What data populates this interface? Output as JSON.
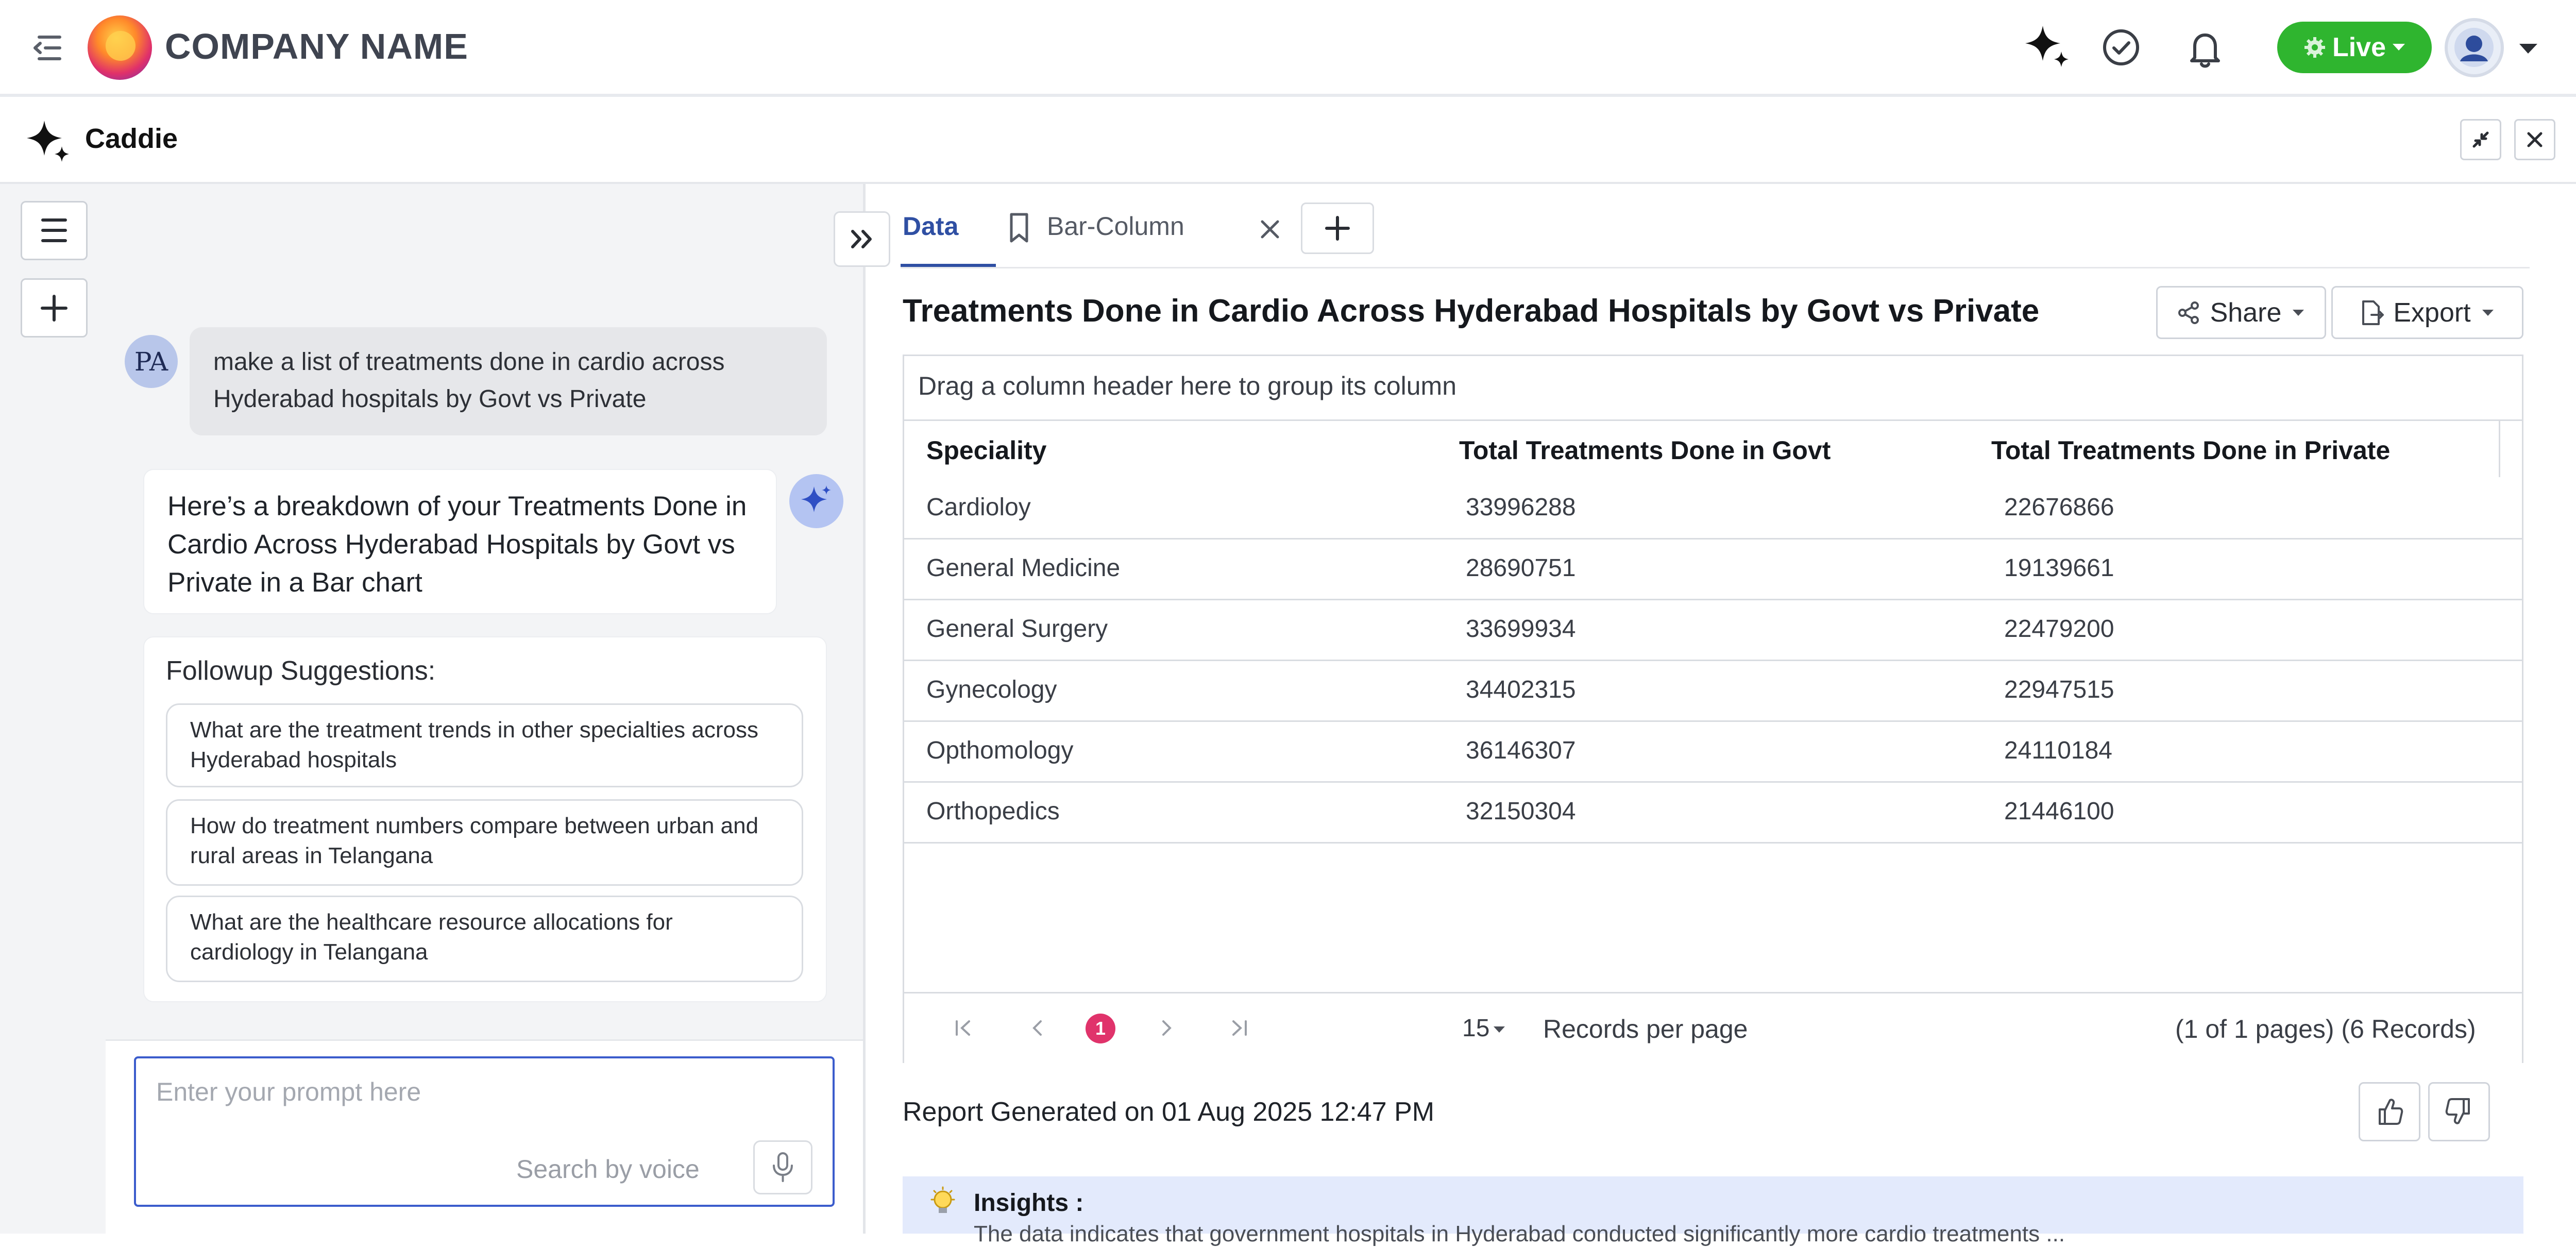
{
  "header": {
    "company_name": "COMPANY NAME",
    "live_label": "Live",
    "icons": [
      "menu-collapse-icon",
      "sparkle-icon",
      "check-circle-icon",
      "bell-icon",
      "avatar",
      "chevron-down-icon"
    ]
  },
  "caddie": {
    "title": "Caddie"
  },
  "chat": {
    "user_initials": "PA",
    "user_message": "make a list of treatments done in cardio across Hyderabad hospitals by Govt vs Private",
    "bot_message": "Here’s a breakdown of your Treatments Done in Cardio Across Hyderabad Hospitals by Govt vs Private in a Bar chart",
    "followup_title": "Followup Suggestions:",
    "suggestions": [
      "What are the treatment trends in other specialties across Hyderabad hospitals",
      "How do treatment numbers compare between urban and rural areas in Telangana",
      "What are the healthcare resource allocations for cardiology in Telangana"
    ],
    "prompt_placeholder": "Enter your prompt here",
    "voice_label": "Search by voice"
  },
  "tabs": [
    {
      "label": "Data",
      "active": true
    },
    {
      "label": "Bar-Column",
      "active": false
    }
  ],
  "report": {
    "title": "Treatments Done in Cardio Across Hyderabad Hospitals by Govt vs Private",
    "share_label": "Share",
    "export_label": "Export",
    "group_hint": "Drag a column header here to group its column",
    "columns": [
      "Speciality",
      "Total Treatments Done in Govt",
      "Total Treatments Done in Private"
    ],
    "rows": [
      [
        "Cardioloy",
        "33996288",
        "22676866"
      ],
      [
        "General Medicine",
        "28690751",
        "19139661"
      ],
      [
        "General Surgery",
        "33699934",
        "22479200"
      ],
      [
        "Gynecology",
        "34402315",
        "22947515"
      ],
      [
        "Opthomology",
        "36146307",
        "24110184"
      ],
      [
        "Orthopedics",
        "32150304",
        "21446100"
      ]
    ],
    "pager": {
      "current_page": "1",
      "page_size": "15",
      "records_label": "Records per page",
      "summary": "(1 of 1 pages) (6 Records)"
    },
    "generated": "Report Generated on 01 Aug 2025 12:47 PM",
    "insights_title": "Insights :",
    "insights_text": "The data indicates that government hospitals in Hyderabad conducted significantly more cardio treatments ..."
  },
  "colors": {
    "accent": "#2f4fa3",
    "live": "#2fb52f",
    "page_active": "#e0336b",
    "insights_bg": "#e3eafc"
  }
}
